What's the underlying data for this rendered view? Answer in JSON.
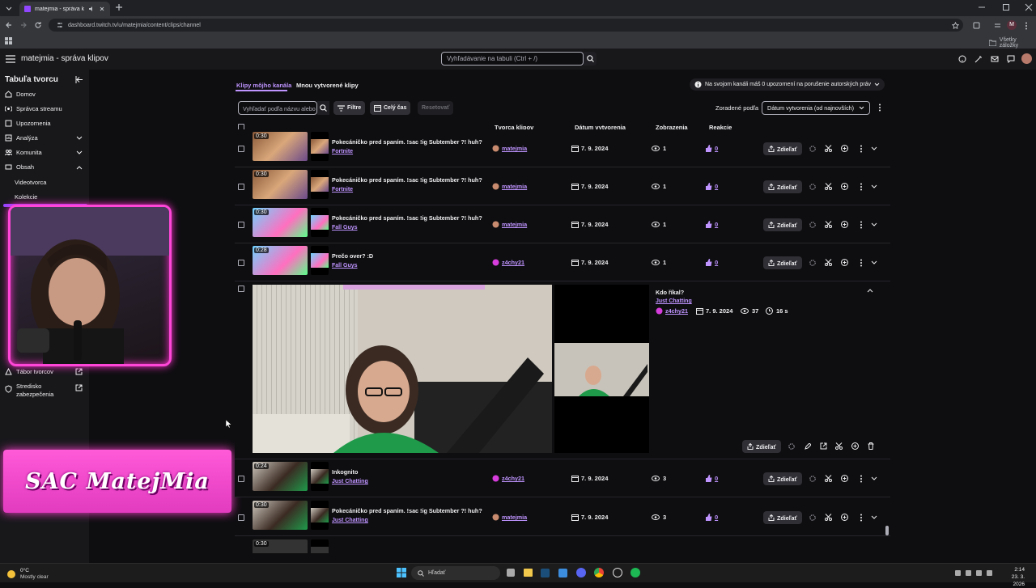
{
  "browser": {
    "tab_title": "matejmia - správa klipov",
    "url": "dashboard.twitch.tv/u/matejmia/content/clips/channel",
    "bookmarks_label": "Všetky záložky",
    "profile_initial": "M"
  },
  "header": {
    "page_title": "matejmia - správa klipov",
    "search_placeholder": "Vyhľadávanie na tabuli (Ctrl + /)"
  },
  "sidebar": {
    "title": "Tabuľa tvorcu",
    "items": [
      {
        "label": "Domov",
        "icon": "home-icon"
      },
      {
        "label": "Správca streamu",
        "icon": "stream-manager-icon"
      },
      {
        "label": "Upozornenia",
        "icon": "alerts-icon"
      },
      {
        "label": "Analýza",
        "icon": "analytics-icon",
        "expandable": true
      },
      {
        "label": "Komunita",
        "icon": "community-icon",
        "expandable": true
      },
      {
        "label": "Obsah",
        "icon": "content-icon",
        "expandable": true,
        "expanded": true
      }
    ],
    "subitems": [
      "Videotvorca",
      "Kolekcie"
    ],
    "bottom_items": [
      {
        "label": "Tábor tvorcov",
        "icon": "camp-icon"
      },
      {
        "label": "Stredisko zabezpečenia",
        "icon": "shield-icon"
      }
    ]
  },
  "overlay": {
    "banner_text": "SAC MatejMia"
  },
  "tabs": {
    "active": "Klipy môjho kanála",
    "other": "Mnou vytvorené klipy"
  },
  "notice": "Na svojom kanáli máš 0 upozornení na porušenie autorských práv",
  "toolbar": {
    "filter_placeholder": "Vyhľadať podľa názvu alebo",
    "filters": "Filtre",
    "time": "Celý čas",
    "reset": "Resetovať",
    "sort_label": "Zoradené podľa",
    "sort_value": "Dátum vytvorenia (od najnovších)"
  },
  "columns": {
    "creator": "Tvorca klipov",
    "date": "Dátum vytvorenia",
    "views": "Zobrazenia",
    "reactions": "Reakcie"
  },
  "share_label": "Zdieľať",
  "clips": [
    {
      "duration": "0:30",
      "title": "Pokecáničko pred spaním. !sac !ig Subtember ?! huh?",
      "category": "Fortnite",
      "creator": "matejmia",
      "date": "7. 9. 2024",
      "views": "1",
      "reactions": "0"
    },
    {
      "duration": "0:30",
      "title": "Pokecáničko pred spaním. !sac !ig Subtember ?! huh?",
      "category": "Fortnite",
      "creator": "matejmia",
      "date": "7. 9. 2024",
      "views": "1",
      "reactions": "0"
    },
    {
      "duration": "0:30",
      "title": "Pokecáničko pred spaním. !sac !ig Subtember ?! huh?",
      "category": "Fall Guys",
      "creator": "matejmia",
      "date": "7. 9. 2024",
      "views": "1",
      "reactions": "0"
    },
    {
      "duration": "0:28",
      "title": "Prečo over? :D",
      "category": "Fall Guys",
      "creator": "z4chy21",
      "date": "7. 9. 2024",
      "views": "1",
      "reactions": "0"
    }
  ],
  "expanded_clip": {
    "title": "Kdo říkal?",
    "category": "Just Chatting",
    "creator": "z4chy21",
    "date": "7. 9. 2024",
    "views": "37",
    "length": "16 s",
    "share": "Zdieľať"
  },
  "clips_after": [
    {
      "duration": "0:24",
      "title": "Inkognito",
      "category": "Just Chatting",
      "creator": "z4chy21",
      "date": "7. 9. 2024",
      "views": "3",
      "reactions": "0"
    },
    {
      "duration": "0:30",
      "title": "Pokecáničko pred spaním. !sac !ig Subtember ?! huh?",
      "category": "Just Chatting",
      "creator": "matejmia",
      "date": "7. 9. 2024",
      "views": "3",
      "reactions": "0"
    },
    {
      "duration": "0:30",
      "title": "",
      "category": "",
      "creator": "",
      "date": "",
      "views": "",
      "reactions": ""
    }
  ],
  "taskbar": {
    "weather_temp": "0°C",
    "weather_desc": "Mostly clear",
    "search": "Hľadať",
    "time": "2:14",
    "date": "23. 3. 2026"
  },
  "colors": {
    "accent": "#bf94ff",
    "bg": "#0e0e10",
    "panel": "#18181b",
    "neon": "#ff3fd0"
  }
}
